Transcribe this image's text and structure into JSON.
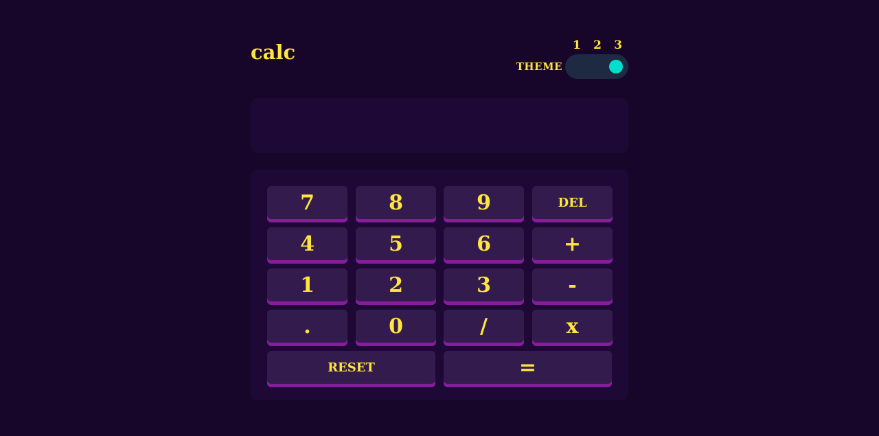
{
  "app": {
    "title": "calc"
  },
  "theme": {
    "label": "THEME",
    "options": [
      "1",
      "2",
      "3"
    ],
    "selected": "3",
    "colors": {
      "background": "#17062a",
      "panel": "#1e0836",
      "key": "#331c4d",
      "key_shadow": "#881c9e",
      "text": "#ffe53d",
      "toggle_knob": "#00dece"
    }
  },
  "display": {
    "value": ""
  },
  "keys": {
    "k7": "7",
    "k8": "8",
    "k9": "9",
    "del": "DEL",
    "k4": "4",
    "k5": "5",
    "k6": "6",
    "plus": "+",
    "k1": "1",
    "k2": "2",
    "k3": "3",
    "minus": "-",
    "dot": ".",
    "k0": "0",
    "divide": "/",
    "multiply": "x",
    "reset": "RESET",
    "equals": "="
  }
}
